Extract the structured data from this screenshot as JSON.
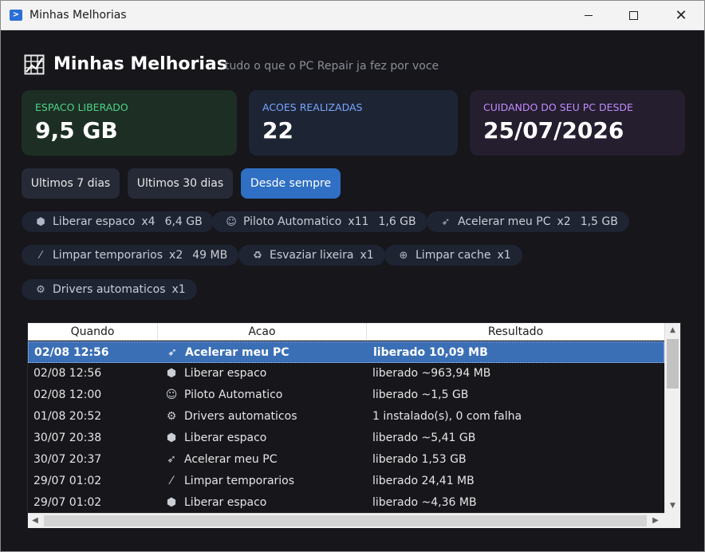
{
  "window": {
    "title": "Minhas Melhorias"
  },
  "header": {
    "title": "Minhas Melhorias",
    "subtitle": "tudo o que o PC Repair ja fez por voce"
  },
  "cards": [
    {
      "label": "ESPACO LIBERADO",
      "value": "9,5 GB",
      "color": "#4fd28a"
    },
    {
      "label": "ACOES REALIZADAS",
      "value": "22",
      "color": "#7aa5ff"
    },
    {
      "label": "CUIDANDO DO SEU PC DESDE",
      "value": "25/07/2026",
      "color": "#c28bff"
    }
  ],
  "filters": [
    {
      "label": "Ultimos 7 dias",
      "active": false
    },
    {
      "label": "Ultimos 30 dias",
      "active": false
    },
    {
      "label": "Desde sempre",
      "active": true
    }
  ],
  "chips": [
    {
      "icon": "cube-icon",
      "name": "Liberar espaco",
      "count": "x4",
      "size": "6,4 GB"
    },
    {
      "icon": "robot-icon",
      "name": "Piloto Automatico",
      "count": "x11",
      "size": "1,6 GB"
    },
    {
      "icon": "rocket-icon",
      "name": "Acelerar meu PC",
      "count": "x2",
      "size": "1,5 GB"
    },
    {
      "icon": "broom-icon",
      "name": "Limpar temporarios",
      "count": "x2",
      "size": "49 MB"
    },
    {
      "icon": "recycle-icon",
      "name": "Esvaziar lixeira",
      "count": "x1",
      "size": ""
    },
    {
      "icon": "globe-icon",
      "name": "Limpar cache",
      "count": "x1",
      "size": ""
    },
    {
      "icon": "gears-icon",
      "name": "Drivers automaticos",
      "count": "x1",
      "size": ""
    }
  ],
  "table": {
    "columns": [
      "Quando",
      "Acao",
      "Resultado"
    ],
    "rows": [
      {
        "when": "02/08 12:56",
        "icon": "rocket-icon",
        "action": "Acelerar meu PC",
        "result": "liberado 10,09 MB",
        "selected": true
      },
      {
        "when": "02/08 12:56",
        "icon": "cube-icon",
        "action": "Liberar espaco",
        "result": "liberado ~963,94 MB"
      },
      {
        "when": "02/08 12:00",
        "icon": "robot-icon",
        "action": "Piloto Automatico",
        "result": "liberado ~1,5 GB"
      },
      {
        "when": "01/08 20:52",
        "icon": "gears-icon",
        "action": "Drivers automaticos",
        "result": "1 instalado(s), 0 com falha"
      },
      {
        "when": "30/07 20:38",
        "icon": "cube-icon",
        "action": "Liberar espaco",
        "result": "liberado ~5,41 GB"
      },
      {
        "when": "30/07 20:37",
        "icon": "rocket-icon",
        "action": "Acelerar meu PC",
        "result": "liberado 1,53 GB"
      },
      {
        "when": "29/07 01:02",
        "icon": "broom-icon",
        "action": "Limpar temporarios",
        "result": "liberado 24,41 MB"
      },
      {
        "when": "29/07 01:02",
        "icon": "cube-icon",
        "action": "Liberar espaco",
        "result": "liberado ~4,36 MB"
      }
    ]
  },
  "colors": {
    "accent": "#2f6fc4",
    "background": "#16161b",
    "selected_row": "#3b6fb5"
  }
}
